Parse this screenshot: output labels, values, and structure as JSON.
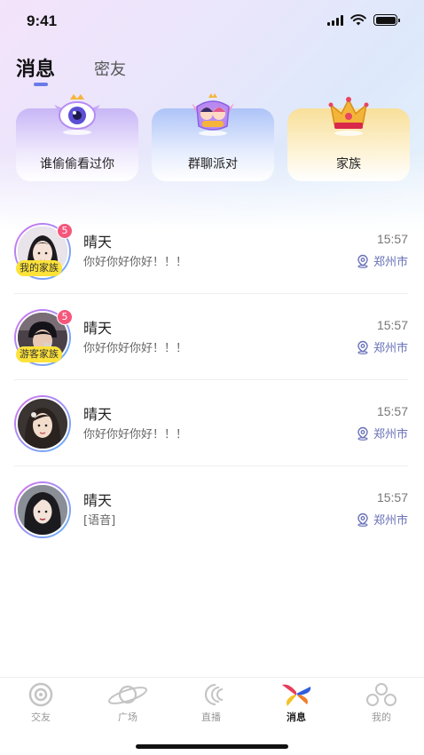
{
  "status_bar": {
    "time": "9:41"
  },
  "tabs": [
    {
      "label": "消息",
      "active": true
    },
    {
      "label": "密友",
      "active": false
    }
  ],
  "features": [
    {
      "label": "谁偷偷看过你",
      "icon": "eye-icon"
    },
    {
      "label": "群聊派对",
      "icon": "couple-badge-icon"
    },
    {
      "label": "家族",
      "icon": "crown-icon"
    }
  ],
  "conversations": [
    {
      "name": "晴天",
      "message": "你好你好你好！！！",
      "time": "15:57",
      "location": "郑州市",
      "unread": "5",
      "tag": "我的家族"
    },
    {
      "name": "晴天",
      "message": "你好你好你好！！！",
      "time": "15:57",
      "location": "郑州市",
      "unread": "5",
      "tag": "游客家族"
    },
    {
      "name": "晴天",
      "message": "你好你好你好！！！",
      "time": "15:57",
      "location": "郑州市",
      "unread": "",
      "tag": ""
    },
    {
      "name": "晴天",
      "message": "[语音]",
      "time": "15:57",
      "location": "郑州市",
      "unread": "",
      "tag": ""
    }
  ],
  "bottom_nav": [
    {
      "label": "交友",
      "icon": "friends-icon"
    },
    {
      "label": "广场",
      "icon": "planet-icon"
    },
    {
      "label": "直播",
      "icon": "live-icon"
    },
    {
      "label": "消息",
      "icon": "message-icon",
      "active": true
    },
    {
      "label": "我的",
      "icon": "profile-icon"
    }
  ],
  "colors": {
    "accent": "#6a7be8",
    "badge": "#f5577b",
    "tag": "#fde23a",
    "location": "#6a72b8"
  }
}
